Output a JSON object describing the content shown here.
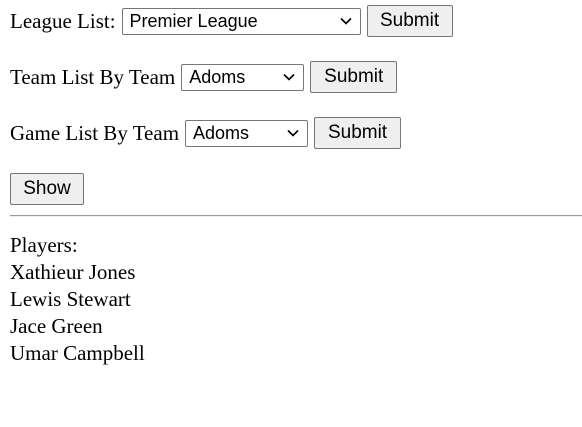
{
  "league_form": {
    "label": "League List:",
    "selected": "Premier League",
    "submit_label": "Submit"
  },
  "team_form": {
    "label": "Team List By Team",
    "selected": "Adoms",
    "submit_label": "Submit"
  },
  "game_form": {
    "label": "Game List By Team",
    "selected": "Adoms",
    "submit_label": "Submit"
  },
  "show_label": "Show",
  "players": {
    "heading": "Players:",
    "items": [
      "Xathieur Jones",
      "Lewis Stewart",
      "Jace Green",
      "Umar Campbell"
    ]
  }
}
